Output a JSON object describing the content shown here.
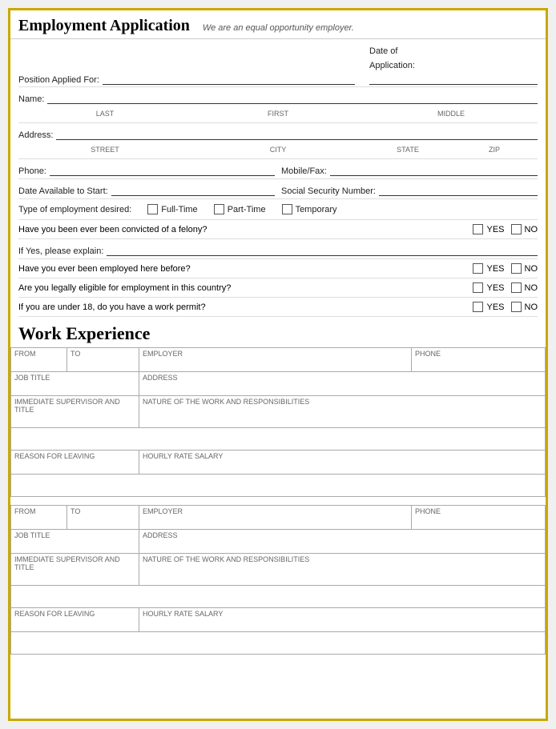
{
  "header": {
    "title": "Employment Application",
    "subtitle": "We are an equal opportunity employer."
  },
  "form": {
    "position_label": "Position Applied For:",
    "date_label": "Date of",
    "date_label2": "Application:",
    "name_label": "Name:",
    "name_sublabels": [
      "LAST",
      "FIRST",
      "MIDDLE"
    ],
    "address_label": "Address:",
    "address_sublabels": [
      "STREET",
      "CITY",
      "STATE",
      "ZIP"
    ],
    "phone_label": "Phone:",
    "mobile_label": "Mobile/Fax:",
    "date_avail_label": "Date Available to Start:",
    "ssn_label": "Social Security Number:",
    "emp_type_label": "Type of employment desired:",
    "fulltime_label": "Full-Time",
    "parttime_label": "Part-Time",
    "temporary_label": "Temporary",
    "felony_q": "Have you been ever been convicted of a felony?",
    "yes_label": "YES",
    "no_label": "NO",
    "explain_label": "If Yes, please explain:",
    "employed_here_q": "Have you ever been employed here before?",
    "eligible_q": "Are you legally eligible for employment in this country?",
    "work_permit_q": "If you are under 18, do you have a work permit?"
  },
  "work_experience": {
    "title": "Work Experience",
    "table_headers": {
      "from": "FROM",
      "to": "TO",
      "employer": "EMPLOYER",
      "phone": "PHONE",
      "job_title": "JOB TITLE",
      "address": "ADDRESS",
      "supervisor": "Immediate supervisor and title",
      "nature": "Nature of the work and responsibilities",
      "reason": "Reason for Leaving",
      "hourly": "Hourly Rate Salary"
    }
  }
}
